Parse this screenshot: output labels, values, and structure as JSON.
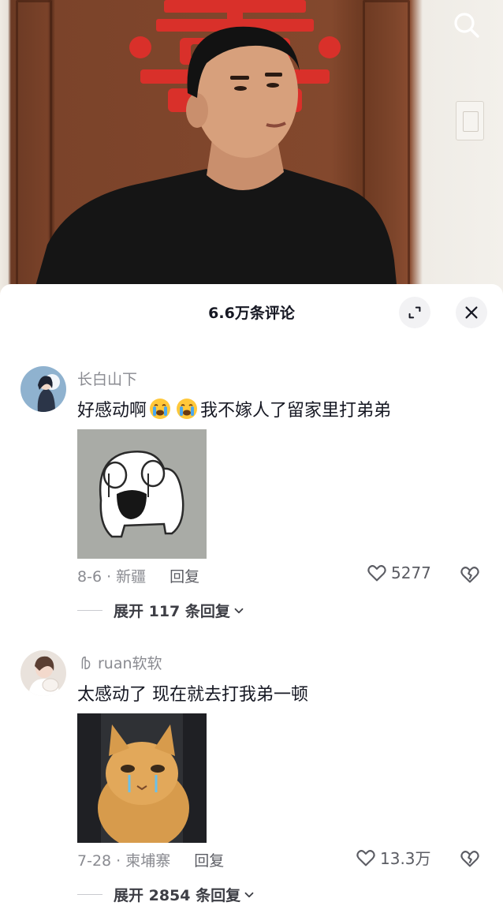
{
  "header": {
    "title": "6.6万条评论"
  },
  "comments": [
    {
      "username": "长白山下",
      "text_before": "好感动啊",
      "text_after": "我不嫁人了留家里打弟弟",
      "emoji": "loudly-crying-face",
      "date_location": "8-6 · 新疆",
      "reply_label": "回复",
      "likes": "5277",
      "expand_label": "展开 117 条回复"
    },
    {
      "username": "ruan软软",
      "text": "太感动了 现在就去打我弟一顿",
      "date_location": "7-28 · 柬埔寨",
      "reply_label": "回复",
      "likes": "13.3万",
      "expand_label": "展开 2854 条回复"
    }
  ],
  "icons": {
    "search": "search-icon",
    "expand": "expand-icon",
    "close": "close-icon",
    "like": "heart-outline-icon",
    "dislike": "broken-heart-icon",
    "chevron": "chevron-down-icon"
  },
  "colors": {
    "title": "#161823",
    "secondary": "#8a8b91",
    "wallRed": "#d9302a"
  }
}
